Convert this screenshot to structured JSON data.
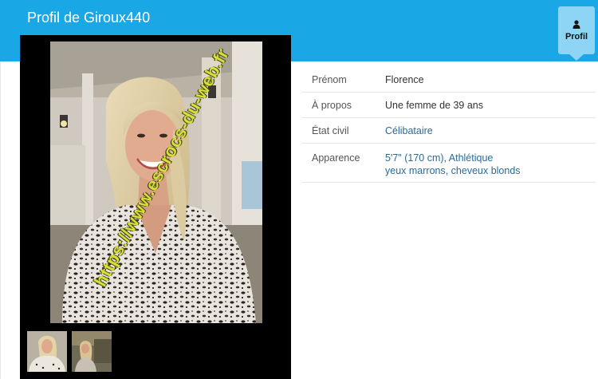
{
  "header": {
    "title": "Profil de Giroux440",
    "profile_tab_label": "Profil"
  },
  "photos": {
    "watermark": "https://www.escrocs-du-web.fr",
    "thumbnail_count": 2
  },
  "info": {
    "rows": [
      {
        "label": "Prénom",
        "value": "Florence"
      },
      {
        "label": "À propos",
        "value": "Une femme de 39 ans"
      },
      {
        "label": "État civil",
        "value": "Célibataire"
      },
      {
        "label": "Apparence",
        "value": "5'7\" (170 cm), Athlétique",
        "value2": "yeux marrons, cheveux blonds"
      }
    ]
  },
  "colors": {
    "header_bg": "#1aa7e6",
    "tab_bg": "#8ed4f4",
    "link": "#2a6a9a",
    "watermark": "#d7df3a"
  }
}
